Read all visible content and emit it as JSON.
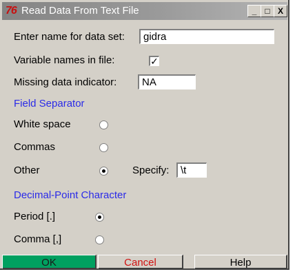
{
  "window": {
    "title": "Read Data From Text File",
    "icon_text": "76",
    "minimize_label": "_",
    "maximize_label": "□",
    "close_label": "X"
  },
  "form": {
    "dataset_label": "Enter name for data set:",
    "dataset_value": "gidra",
    "varnames_label": "Variable names in file:",
    "varnames_checked": true,
    "missing_label": "Missing data indicator:",
    "missing_value": "NA"
  },
  "field_separator": {
    "title": "Field Separator",
    "options": [
      {
        "label": "White space",
        "selected": false
      },
      {
        "label": "Commas",
        "selected": false
      },
      {
        "label": "Other",
        "selected": true
      }
    ],
    "specify_label": "Specify:",
    "specify_value": "\\t"
  },
  "decimal_point": {
    "title": "Decimal-Point Character",
    "options": [
      {
        "label": "Period [.]",
        "selected": true
      },
      {
        "label": "Comma [,]",
        "selected": false
      }
    ]
  },
  "buttons": {
    "ok": "OK",
    "cancel": "Cancel",
    "help": "Help"
  },
  "colors": {
    "ok_button": "#00a060",
    "section_title": "#2a2ae8",
    "cancel_text": "#d01010"
  }
}
